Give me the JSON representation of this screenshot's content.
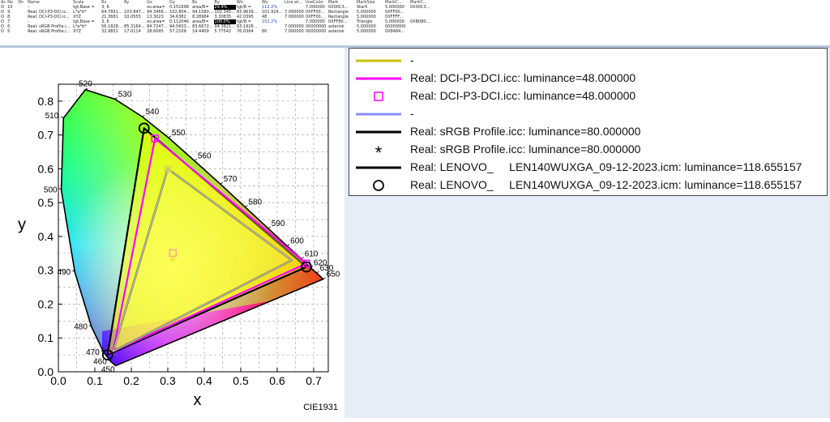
{
  "grid": {
    "columns": [
      "Ac",
      "No",
      "On",
      "Name",
      "Scale",
      "Rx",
      "Ry",
      "Gx",
      "Gy",
      "Bx",
      "By",
      "Wx",
      "Wy",
      "Line wi...",
      "lineColor",
      "Mark",
      "MarkSize",
      "MarkC...",
      "MarkC..."
    ],
    "rows": [
      [
        "O",
        "10",
        "",
        "-",
        "tgt,Base =",
        "3, 6",
        "",
        "ov.area=",
        "0.151898",
        "area/B=",
        "29.9%",
        "tgt/B =",
        "112.2%",
        "",
        "7.000000",
        "0X00C3...",
        "Star5",
        "5.000000",
        "0X00C3..."
      ],
      [
        "O",
        "9",
        "",
        "Real: DCI-P3-DCI.ic...",
        "L*a*b*",
        "64.7831...",
        "103.847...",
        "94.3466...",
        "102.804...",
        "94.1580...",
        "102.345...",
        "83.9639...",
        "101.924...",
        "7.000000",
        "0XFF00...",
        "Rectangle",
        "5.000000",
        "0XFF00..."
      ],
      [
        "O",
        "8",
        "",
        "Real: DCI-P3-DCI.ic...",
        "XYZ",
        "21.3681",
        "10.0555",
        "13.3023",
        "34.6382",
        "8.28984",
        "3.30835",
        "42.0395",
        "48",
        "7.000000",
        "0XFF00...",
        "Rectangle",
        "5.000000",
        "0XFFFF..."
      ],
      [
        "O",
        "7",
        "",
        "-",
        "tgt,Base =",
        "3, 6",
        "",
        "ov.area=",
        "0.112046",
        "area/B=",
        "100.0%",
        "tgt/B =",
        "152.2%",
        "",
        "7.000000",
        "0XFF80...",
        "Triangle",
        "5.000000",
        "0XB080..."
      ],
      [
        "O",
        "6",
        "",
        "Real: sRGB Profile.i...",
        "L*a*b*",
        "56.1828...",
        "85.3164...",
        "84.7247...",
        "94.5603...",
        "83.6672...",
        "94.3821...",
        "83.1926...",
        "",
        "7.000000",
        "00000000",
        "asterisk",
        "5.000000",
        "00000000"
      ],
      [
        "O",
        "5",
        "",
        "Real: sRGB Profile.i...",
        "XYZ",
        "32.9831",
        "17.0114",
        "28.6095",
        "57.2109",
        "14.4409",
        "5.77542",
        "76.0364",
        "80",
        "7.000000",
        "00000000",
        "asterisk",
        "5.000000",
        "0X8484..."
      ]
    ]
  },
  "chart_data": {
    "type": "scatter",
    "title": "",
    "xlabel": "x",
    "ylabel": "y",
    "xlim": [
      0.0,
      0.74
    ],
    "ylim": [
      0.0,
      0.85
    ],
    "xticks": [
      "0.0",
      "0.1",
      "0.2",
      "0.3",
      "0.4",
      "0.5",
      "0.6",
      "0.7"
    ],
    "yticks": [
      "0.0",
      "0.1",
      "0.2",
      "0.3",
      "0.4",
      "0.5",
      "0.6",
      "0.7",
      "0.8"
    ],
    "grid": true,
    "footer": "CIE1931",
    "locus_labels": [
      {
        "label": "450",
        "x": 0.157,
        "y": 0.018
      },
      {
        "label": "460",
        "x": 0.144,
        "y": 0.03
      },
      {
        "label": "470",
        "x": 0.124,
        "y": 0.058
      },
      {
        "label": "480",
        "x": 0.091,
        "y": 0.133
      },
      {
        "label": "490",
        "x": 0.045,
        "y": 0.295
      },
      {
        "label": "500",
        "x": 0.008,
        "y": 0.538
      },
      {
        "label": "510",
        "x": 0.014,
        "y": 0.75
      },
      {
        "label": "520",
        "x": 0.074,
        "y": 0.834
      },
      {
        "label": "530",
        "x": 0.155,
        "y": 0.806
      },
      {
        "label": "540",
        "x": 0.23,
        "y": 0.754
      },
      {
        "label": "550",
        "x": 0.302,
        "y": 0.692
      },
      {
        "label": "560",
        "x": 0.373,
        "y": 0.624
      },
      {
        "label": "570",
        "x": 0.444,
        "y": 0.555
      },
      {
        "label": "580",
        "x": 0.512,
        "y": 0.487
      },
      {
        "label": "590",
        "x": 0.575,
        "y": 0.424
      },
      {
        "label": "600",
        "x": 0.627,
        "y": 0.372
      },
      {
        "label": "610",
        "x": 0.666,
        "y": 0.334
      },
      {
        "label": "620",
        "x": 0.691,
        "y": 0.308
      },
      {
        "label": "630",
        "x": 0.708,
        "y": 0.292
      },
      {
        "label": "650",
        "x": 0.726,
        "y": 0.274
      }
    ],
    "series": [
      {
        "name": "-",
        "color": "#c8c000",
        "points": [
          [
            0.64,
            0.33
          ],
          [
            0.3,
            0.6
          ],
          [
            0.15,
            0.06
          ]
        ],
        "closed": true
      },
      {
        "name": "Real: DCI-P3-DCI.icc: luminance=48.000000",
        "color": "#ff00ff",
        "points": [
          [
            0.68,
            0.32
          ],
          [
            0.265,
            0.69
          ],
          [
            0.15,
            0.06
          ]
        ],
        "closed": true
      },
      {
        "name": "Real: DCI-P3-DCI.icc: luminance=48.000000",
        "color": "#ff00ff",
        "marker": "square",
        "points": [
          [
            0.68,
            0.32
          ],
          [
            0.265,
            0.69
          ],
          [
            0.15,
            0.06
          ],
          [
            0.314,
            0.351
          ]
        ]
      },
      {
        "name": "-",
        "color": "#8c8cff",
        "points": [
          [
            0.64,
            0.33
          ],
          [
            0.3,
            0.6
          ],
          [
            0.15,
            0.06
          ]
        ],
        "closed": true
      },
      {
        "name": "Real: sRGB Profile.icc: luminance=80.000000",
        "color": "#000000",
        "points": [
          [
            0.64,
            0.33
          ],
          [
            0.3,
            0.6
          ],
          [
            0.15,
            0.06
          ]
        ],
        "closed": true
      },
      {
        "name": "Real: sRGB Profile.icc: luminance=80.000000",
        "color": "#000000",
        "marker": "asterisk",
        "points": [
          [
            0.3127,
            0.329
          ]
        ]
      },
      {
        "name": "Real: LENOVO_     LEN140WUXGA_09-12-2023.icm: luminance=118.655157",
        "color": "#000000",
        "points": [
          [
            0.68,
            0.31
          ],
          [
            0.235,
            0.72
          ],
          [
            0.135,
            0.05
          ]
        ],
        "closed": true
      },
      {
        "name": "Real: LENOVO_     LEN140WUXGA_09-12-2023.icm: luminance=118.655157",
        "color": "#000000",
        "marker": "circle",
        "points": [
          [
            0.68,
            0.31
          ],
          [
            0.235,
            0.72
          ],
          [
            0.135,
            0.05
          ]
        ]
      }
    ]
  },
  "legend": [
    {
      "text": "-",
      "kind": "line",
      "color": "#c8c000"
    },
    {
      "text": "Real: DCI-P3-DCI.icc: luminance=48.000000",
      "kind": "line",
      "color": "#ff00ff"
    },
    {
      "text": "Real: DCI-P3-DCI.icc: luminance=48.000000",
      "kind": "square",
      "color": "#ff00ff"
    },
    {
      "text": "-",
      "kind": "line",
      "color": "#8c8cff"
    },
    {
      "text": "Real: sRGB Profile.icc: luminance=80.000000",
      "kind": "line",
      "color": "#000000"
    },
    {
      "text": "Real: sRGB Profile.icc: luminance=80.000000",
      "kind": "asterisk",
      "color": "#000000"
    },
    {
      "text": "Real: LENOVO_     LEN140WUXGA_09-12-2023.icm: luminance=118.655157",
      "kind": "line",
      "color": "#000000"
    },
    {
      "text": "Real: LENOVO_     LEN140WUXGA_09-12-2023.icm: luminance=118.655157",
      "kind": "circle",
      "color": "#000000"
    }
  ]
}
